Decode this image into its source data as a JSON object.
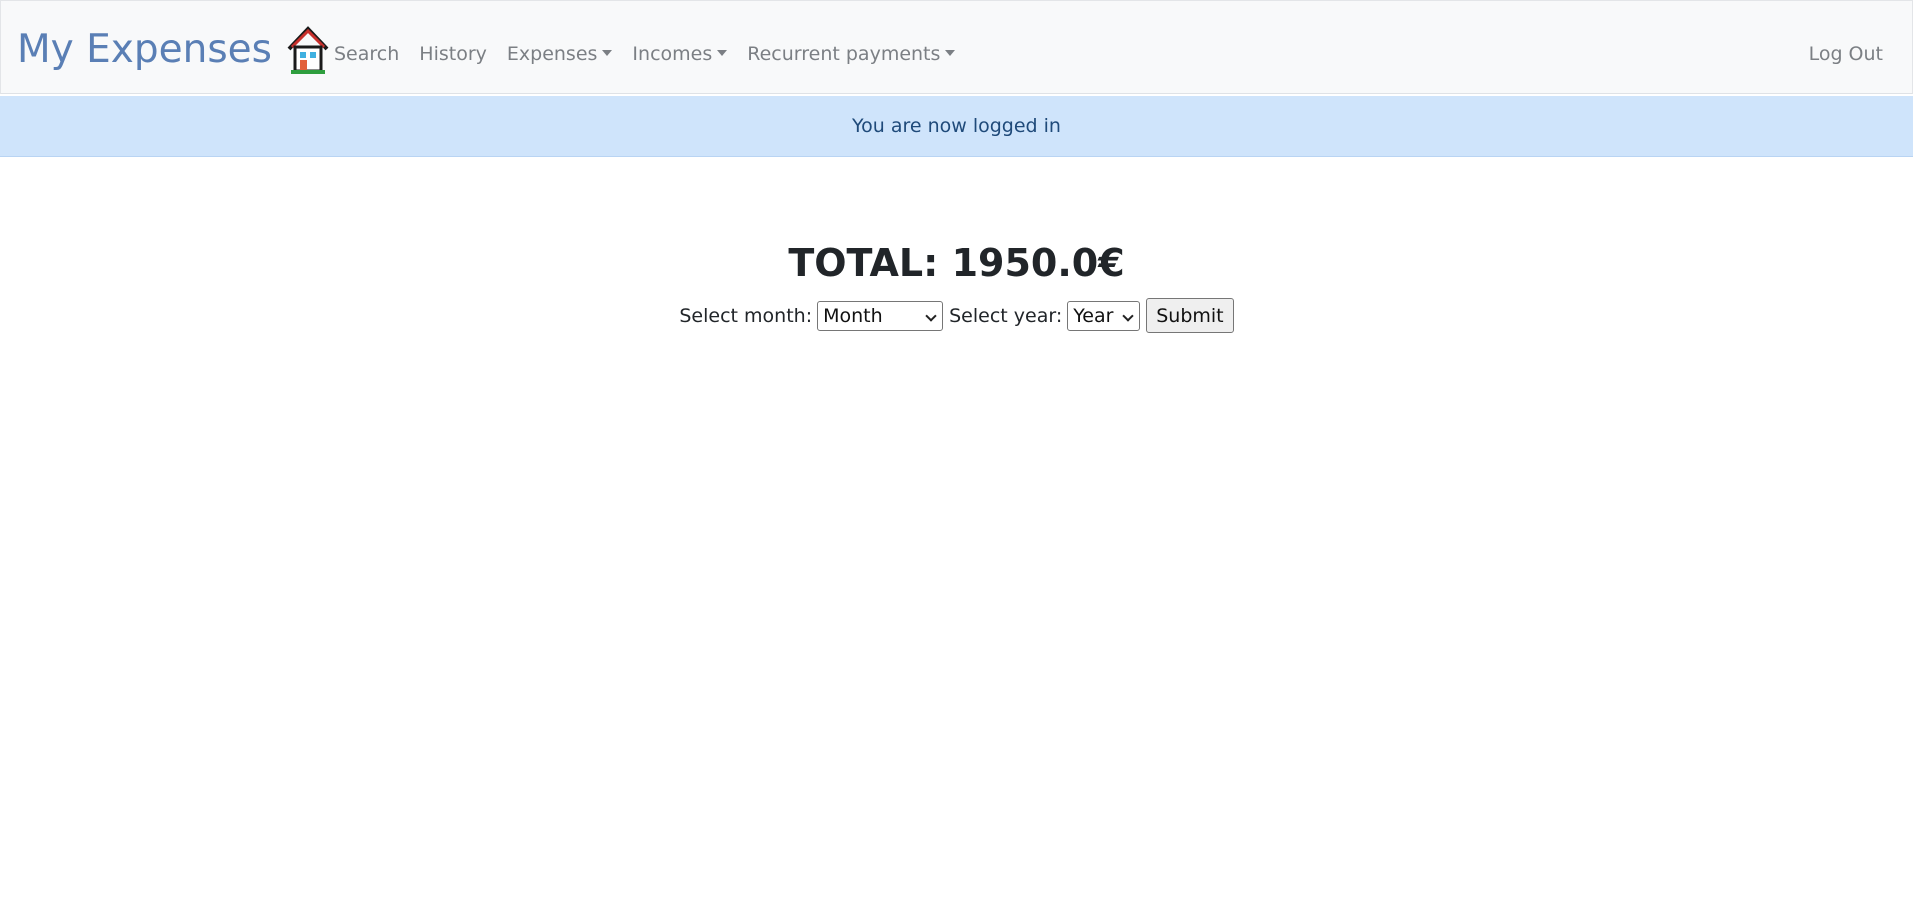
{
  "navbar": {
    "brand": "My Expenses",
    "brand_icon": "house-icon",
    "links": [
      {
        "label": "Search",
        "dropdown": false
      },
      {
        "label": "History",
        "dropdown": false
      },
      {
        "label": "Expenses",
        "dropdown": true
      },
      {
        "label": "Incomes",
        "dropdown": true
      },
      {
        "label": "Recurrent payments",
        "dropdown": true
      }
    ],
    "logout": "Log Out"
  },
  "alert": {
    "message": "You are now logged in",
    "color": "#cfe4fb"
  },
  "main": {
    "total": "TOTAL: 1950.0€",
    "month_label": "Select month:",
    "month_value": "Month",
    "year_label": "Select year:",
    "year_value": "Year",
    "submit_label": "Submit"
  },
  "colors": {
    "brand": "#5a7fb5",
    "nav_link": "#7b7f84",
    "navbar_bg": "#f8f9fa",
    "alert_text": "#1f4a7a"
  }
}
